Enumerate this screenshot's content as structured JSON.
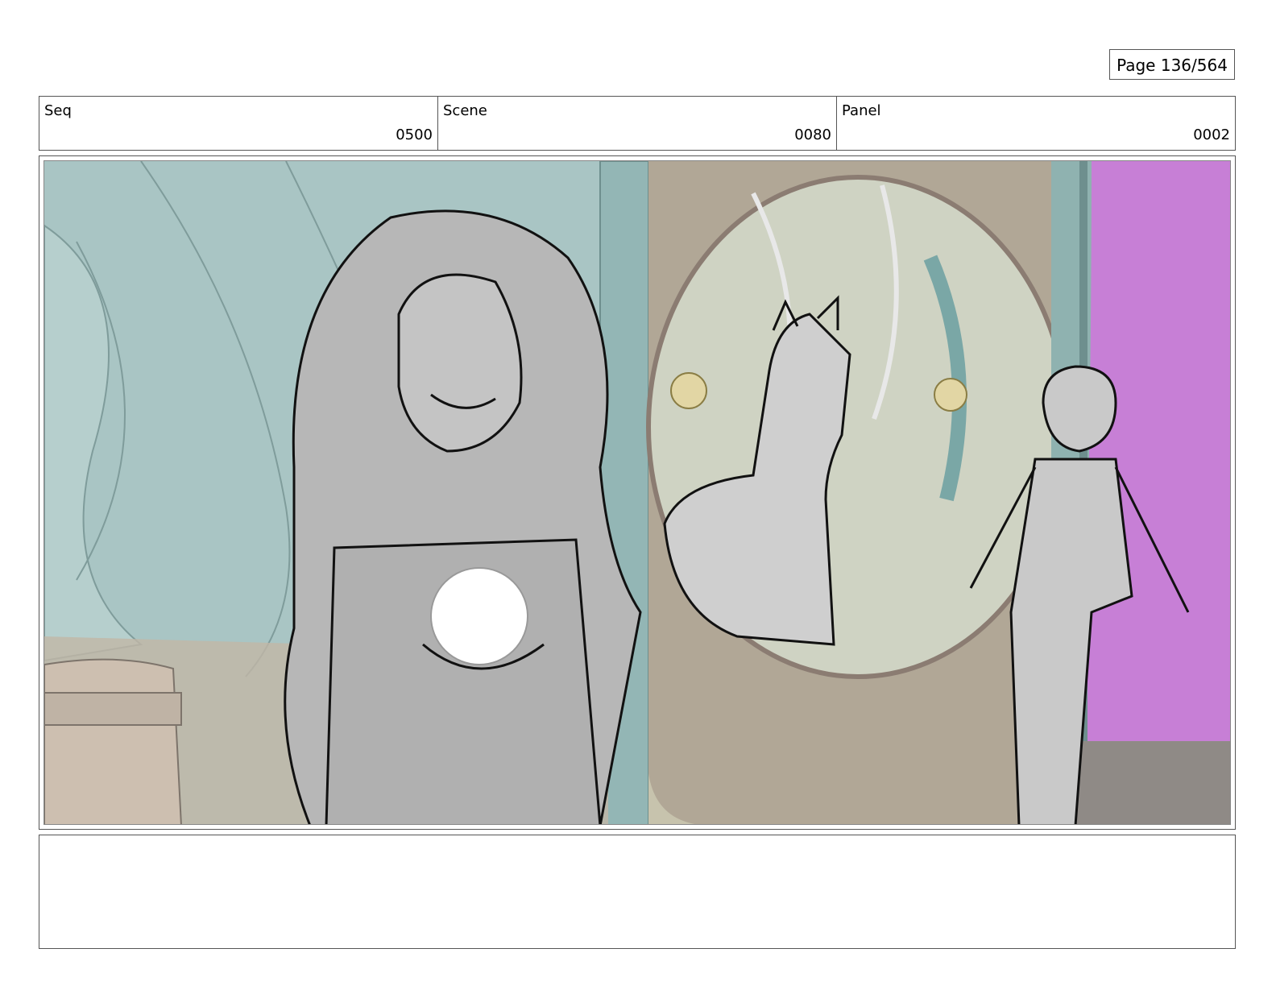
{
  "page": {
    "label": "Page 136/564"
  },
  "header": {
    "seq": {
      "label": "Seq",
      "value": "0500"
    },
    "scene": {
      "label": "Scene",
      "value": "0080"
    },
    "panel": {
      "label": "Panel",
      "value": "0002"
    }
  },
  "panel_image": {
    "description_icon": "storyboard-sketch-icon",
    "colors": {
      "wall": "#a9c5c4",
      "arch_magenta": "#c77fd6",
      "floor": "#8f8a86",
      "gate_brown": "#9e8f84",
      "sketch_fill": "#b7b7b7",
      "ink": "#111111"
    }
  },
  "notes": {
    "text": ""
  }
}
